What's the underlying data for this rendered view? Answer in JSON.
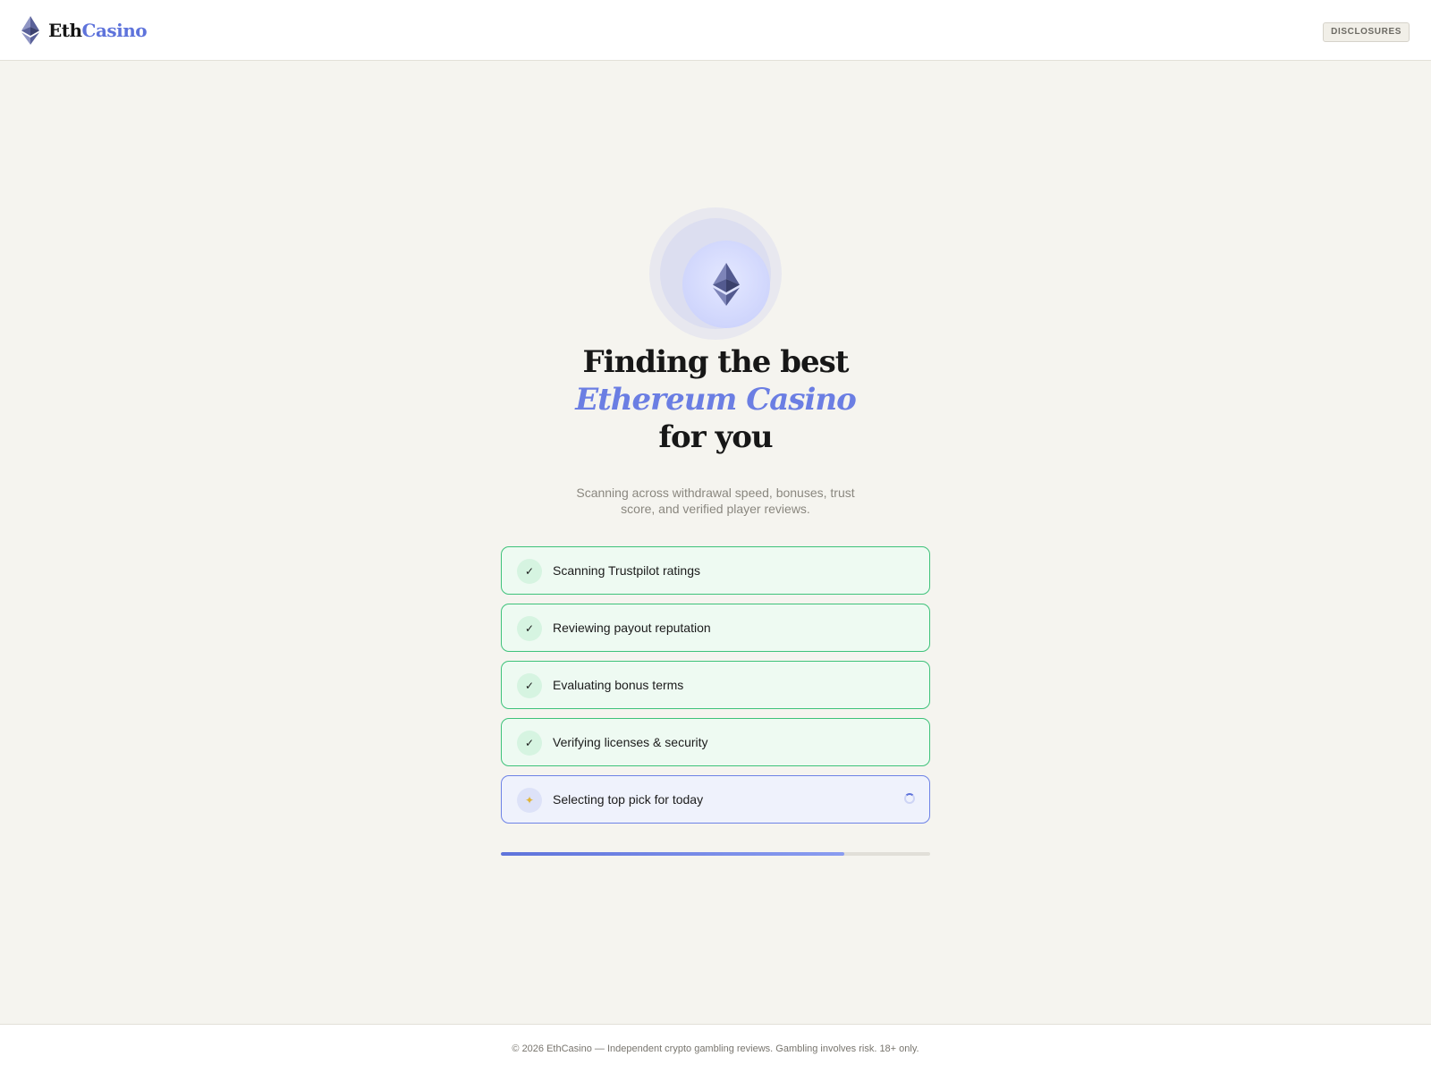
{
  "header": {
    "logo_part1": "Eth",
    "logo_part2": "Casino",
    "logo_icon": "ethereum-icon",
    "disclosures_label": "DISCLOSURES"
  },
  "hero": {
    "icon": "ethereum-icon",
    "title_line1": "Finding the best",
    "title_line2": "Ethereum Casino",
    "title_line3": "for you",
    "subtitle_line1": "Scanning across withdrawal speed, bonuses, trust",
    "subtitle_line2": "score, and verified player reviews."
  },
  "steps": [
    {
      "label": "Scanning Trustpilot ratings",
      "status": "done",
      "icon": "check-icon"
    },
    {
      "label": "Reviewing payout reputation",
      "status": "done",
      "icon": "check-icon"
    },
    {
      "label": "Evaluating bonus terms",
      "status": "done",
      "icon": "check-icon"
    },
    {
      "label": "Verifying licenses & security",
      "status": "done",
      "icon": "check-icon"
    },
    {
      "label": "Selecting top pick for today",
      "status": "in-progress",
      "icon": "sparkles-icon"
    }
  ],
  "progress": {
    "fraction": 0.8
  },
  "footer": {
    "text": "© 2026 EthCasino — Independent crypto gambling reviews. Gambling involves risk. 18+ only."
  },
  "colors": {
    "accent": "#5e73db",
    "success": "#3ec27a",
    "background": "#f5f4ef"
  }
}
